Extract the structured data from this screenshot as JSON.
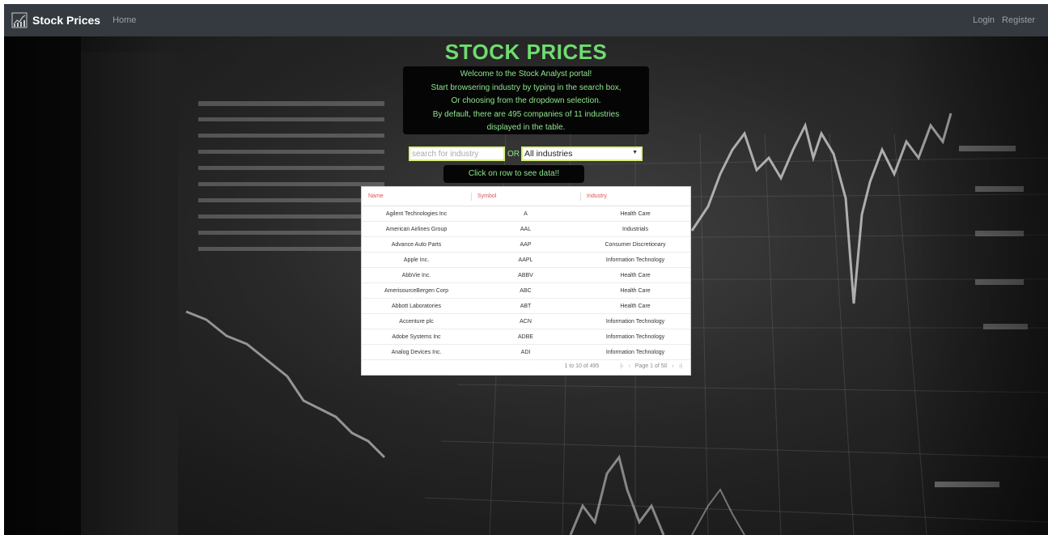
{
  "navbar": {
    "brand": "Stock Prices",
    "home": "Home",
    "login": "Login",
    "register": "Register"
  },
  "title": "STOCK PRICES",
  "welcome_lines": [
    "Welcome to the Stock Analyst portal!",
    "Start browsering industry by typing in the search box,",
    "Or choosing from the dropdown selection.",
    "By default, there are 495 companies of 11 industries",
    "displayed in the table."
  ],
  "search": {
    "placeholder": "search for industry",
    "or_label": "OR",
    "select_value": "All industries"
  },
  "hint": "Click on row to see data!!",
  "table": {
    "headers": [
      "Name",
      "Symbol",
      "Industry"
    ],
    "rows": [
      [
        "Agilent Technologies Inc",
        "A",
        "Health Care"
      ],
      [
        "American Airlines Group",
        "AAL",
        "Industrials"
      ],
      [
        "Advance Auto Parts",
        "AAP",
        "Consumer Discretionary"
      ],
      [
        "Apple Inc.",
        "AAPL",
        "Information Technology"
      ],
      [
        "AbbVie Inc.",
        "ABBV",
        "Health Care"
      ],
      [
        "AmerisourceBergen Corp",
        "ABC",
        "Health Care"
      ],
      [
        "Abbott Laboratories",
        "ABT",
        "Health Care"
      ],
      [
        "Accenture plc",
        "ACN",
        "Information Technology"
      ],
      [
        "Adobe Systems Inc",
        "ADBE",
        "Information Technology"
      ],
      [
        "Analog Devices Inc.",
        "ADI",
        "Information Technology"
      ]
    ],
    "footer": {
      "range": "1 to 10 of 495",
      "page": "Page 1 of 50",
      "first_icon": "first-page-icon",
      "prev_icon": "prev-page-icon",
      "next_icon": "next-page-icon",
      "last_icon": "last-page-icon"
    }
  },
  "colors": {
    "navbar": "#343a40",
    "title_green": "#6fdc6f",
    "text_green": "#8ee68e",
    "header_red": "#e05252",
    "input_border": "#d9f07a"
  }
}
